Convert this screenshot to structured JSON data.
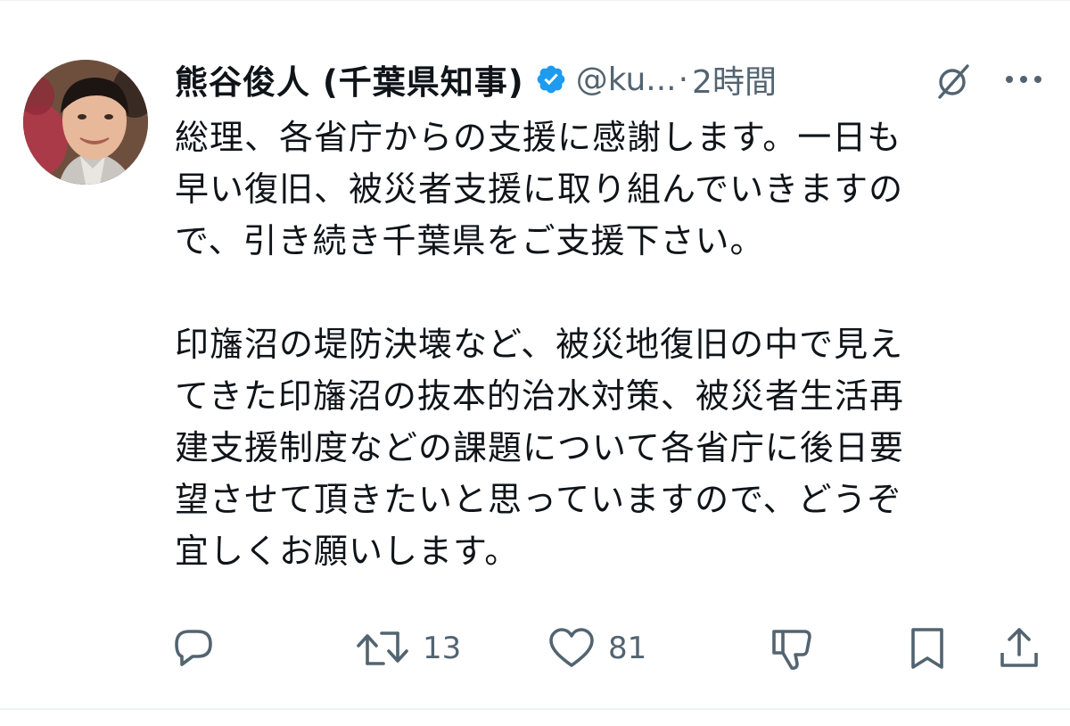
{
  "author": {
    "display_name": "熊谷俊人 (千葉県知事)",
    "handle": "@ku...",
    "separator": "·",
    "time": "2時間",
    "verified": true,
    "verified_color": "#1d9bf0"
  },
  "tweet": {
    "paragraphs": [
      {
        "lines": [
          "総理、各省庁からの支援に感謝します。一日も",
          "早い復旧、被災者支援に取り組んでいきますの",
          "で、引き続き千葉県をご支援下さい。"
        ]
      },
      {
        "lines": [
          "印旛沼の堤防決壊など、被災地復旧の中で見え",
          "てきた印旛沼の抜本的治水対策、被災者生活再",
          "建支援制度などの課題について各省庁に後日要",
          "望させて頂きたいと思っていますので、どうぞ",
          "宜しくお願いします。"
        ]
      }
    ]
  },
  "actions": {
    "reply": {
      "icon": "reply-icon",
      "count": ""
    },
    "retweet": {
      "icon": "retweet-icon",
      "count": "13"
    },
    "like": {
      "icon": "heart-icon",
      "count": "81"
    },
    "downvote": {
      "icon": "thumbs-down-icon"
    },
    "bookmark": {
      "icon": "bookmark-icon"
    },
    "share": {
      "icon": "share-icon"
    }
  },
  "icons": {
    "grok": "grok-icon",
    "more": "more-icon"
  },
  "colors": {
    "text": "#0f1419",
    "secondary": "#536471",
    "divider": "#eff3f4"
  }
}
